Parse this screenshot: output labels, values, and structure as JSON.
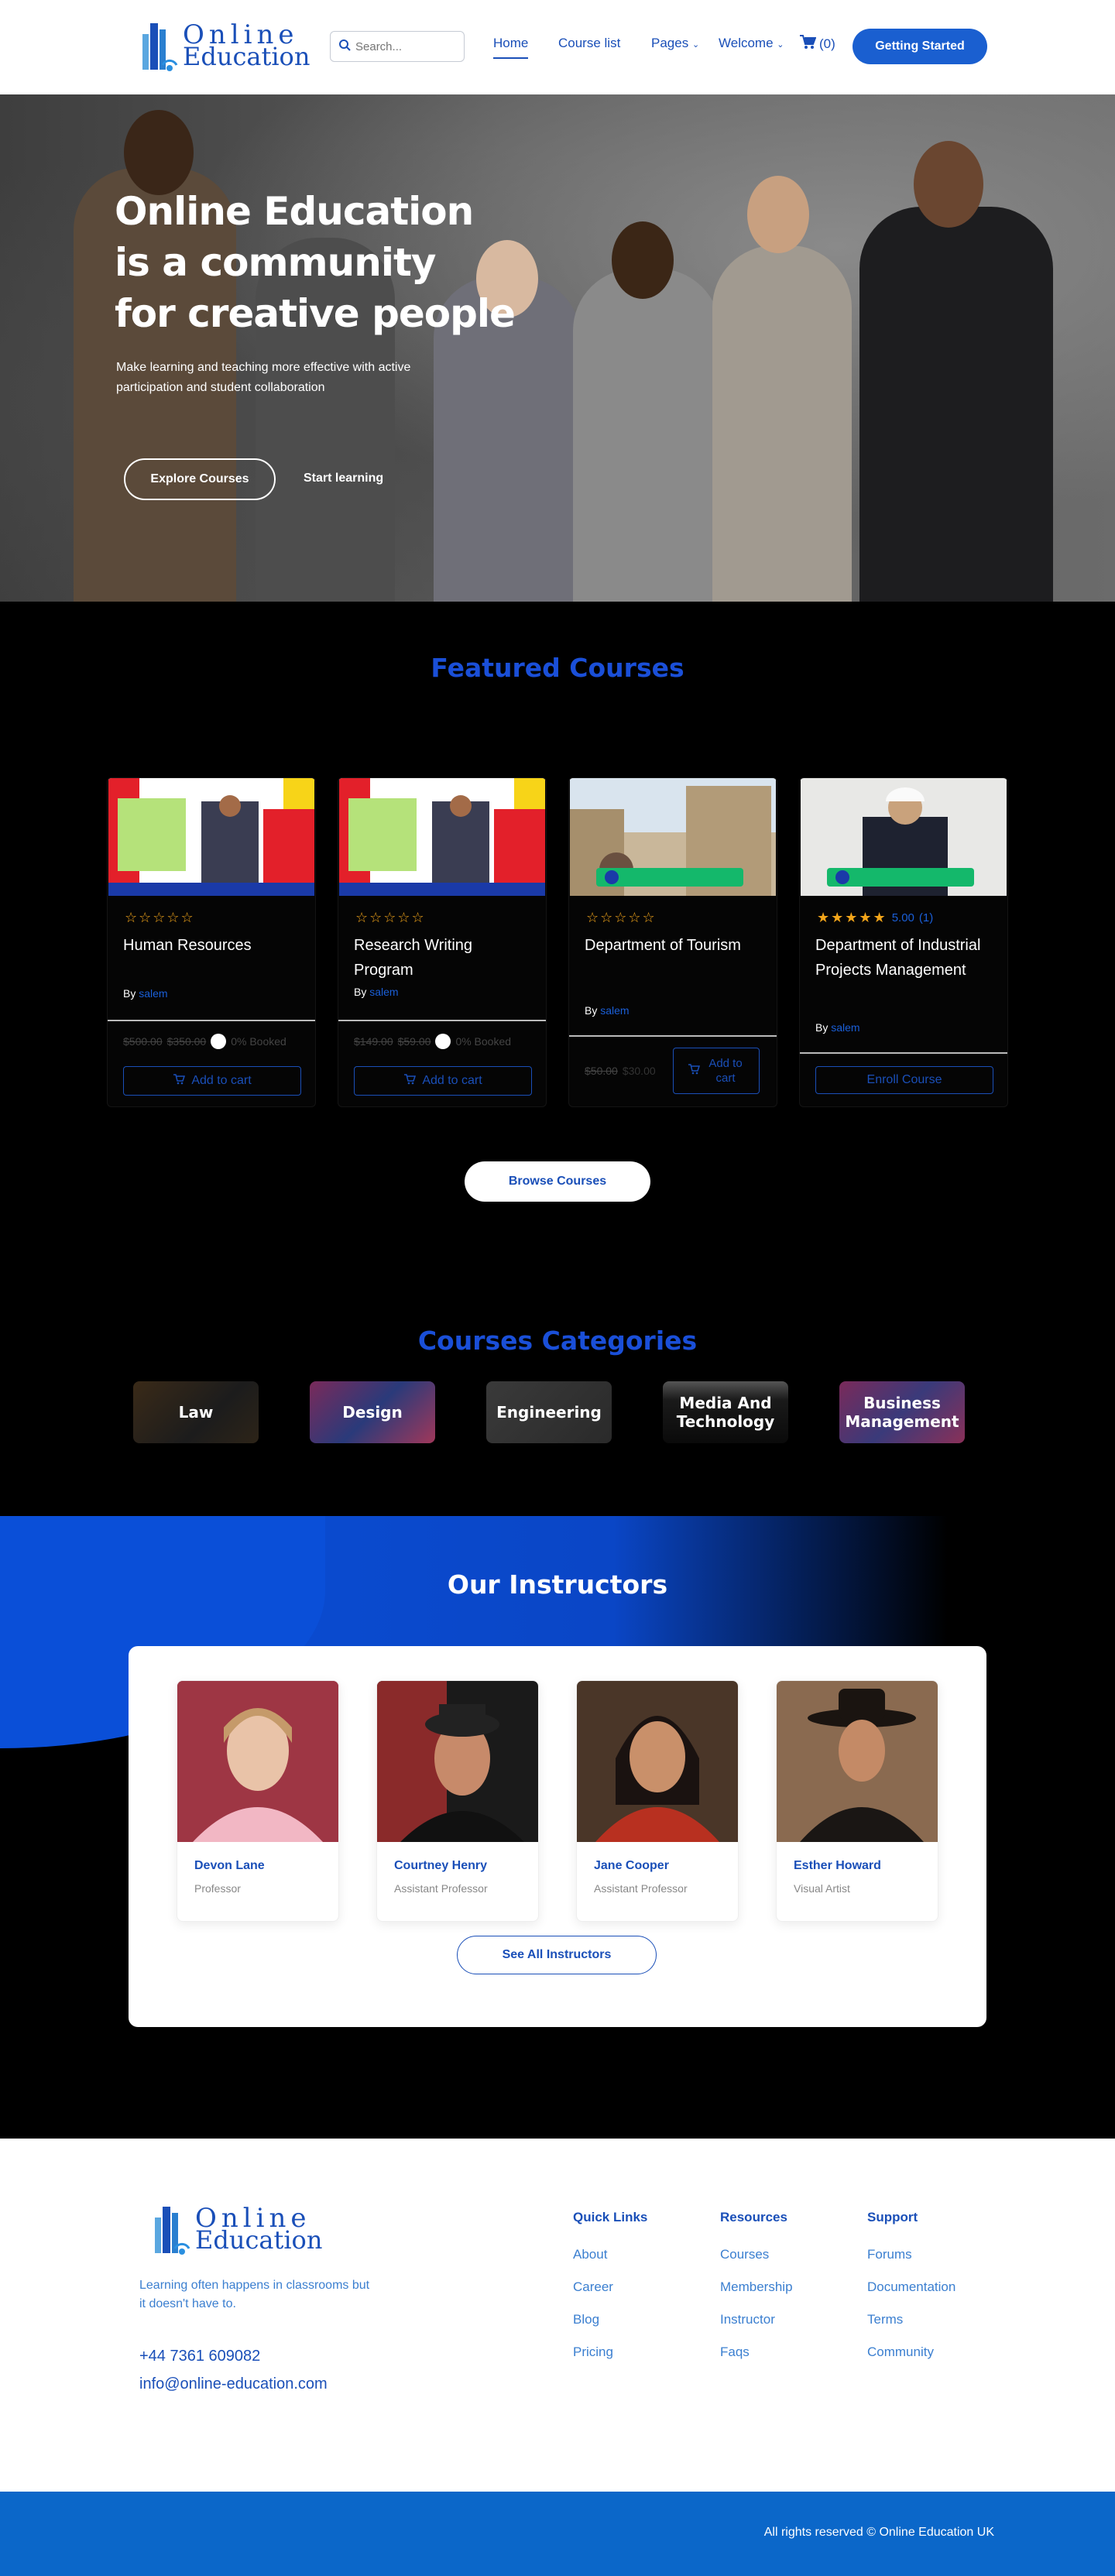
{
  "header": {
    "logo_line1": "Online",
    "logo_line2": "Education",
    "search_placeholder": "Search...",
    "nav": {
      "home": "Home",
      "course_list": "Course list",
      "pages": "Pages",
      "welcome": "Welcome"
    },
    "cart_count": "(0)",
    "cta": "Getting Started"
  },
  "hero": {
    "title": "Online Education\nis a community\nfor creative people",
    "subtitle": "Make learning and teaching more effective with active participation and student collaboration",
    "explore_btn": "Explore Courses",
    "start_btn": "Start learning"
  },
  "featured": {
    "title": "Featured Courses",
    "courses": [
      {
        "title": "Human Resources",
        "by": "By",
        "author": "salem",
        "rating": 0,
        "old_price": "$500.00",
        "new_price": "$350.00",
        "booked": "0% Booked",
        "button": "Add to cart"
      },
      {
        "title": "Research Writing Program",
        "by": "By",
        "author": "salem",
        "rating": 0,
        "old_price": "$149.00",
        "new_price": "$59.00",
        "booked": "0% Booked",
        "button": "Add to cart"
      },
      {
        "title": "Department of Tourism",
        "by": "By",
        "author": "salem",
        "rating": 0,
        "old_price": "$50.00",
        "new_price": "$30.00",
        "button": "Add to cart"
      },
      {
        "title": "Department of Industrial Projects Management",
        "by": "By",
        "author": "salem",
        "rating": 5,
        "rating_value": "5.00",
        "rating_count": "(1)",
        "button": "Enroll Course"
      }
    ],
    "browse_btn": "Browse Courses"
  },
  "categories": {
    "title": "Courses Categories",
    "items": [
      "Law",
      "Design",
      "Engineering",
      "Media And Technology",
      "Business Management"
    ]
  },
  "instructors": {
    "title": "Our Instructors",
    "people": [
      {
        "name": "Devon Lane",
        "role": "Professor"
      },
      {
        "name": "Courtney Henry",
        "role": "Assistant Professor"
      },
      {
        "name": "Jane Cooper",
        "role": "Assistant Professor"
      },
      {
        "name": "Esther Howard",
        "role": "Visual Artist"
      }
    ],
    "see_all": "See All Instructors"
  },
  "footer": {
    "tagline": "Learning often happens in classrooms but it doesn't have to.",
    "phone": "+44 7361 609082",
    "email": "info@online-education.com",
    "columns": [
      {
        "title": "Quick Links",
        "links": [
          "About",
          "Career",
          "Blog",
          "Pricing"
        ]
      },
      {
        "title": "Resources",
        "links": [
          "Courses",
          "Membership",
          "Instructor",
          "Faqs"
        ]
      },
      {
        "title": "Support",
        "links": [
          "Forums",
          "Documentation",
          "Terms",
          "Community"
        ]
      }
    ],
    "copyright": "All rights reserved © Online Education UK"
  },
  "colors": {
    "brand": "#1a4fb8",
    "accent": "#1a5fd0",
    "star": "#f2a51a",
    "footer_bar": "#0b67c9"
  }
}
